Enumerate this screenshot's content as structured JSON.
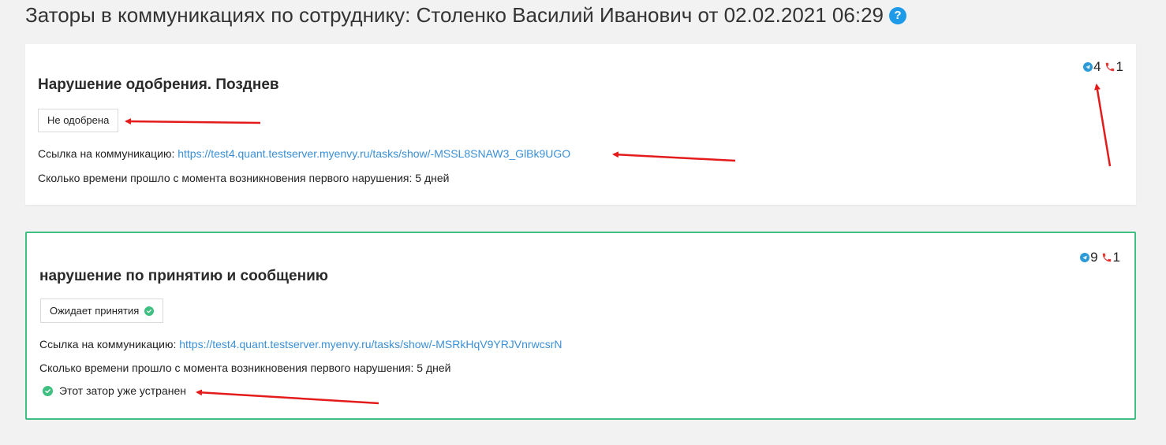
{
  "page": {
    "title": "Заторы в коммуникациях по сотруднику: Столенко Василий Иванович от 02.02.2021 06:29",
    "help_icon": "question-circle-icon"
  },
  "colors": {
    "accent_link": "#3a8fd6",
    "success": "#3fbf81",
    "telegram": "#2c9ad6",
    "phone": "#e53935",
    "annotation_arrow": "#e31b1b"
  },
  "cards": [
    {
      "title": "Нарушение одобрения. Позднев",
      "status": "Не одобрена",
      "status_icon": null,
      "link_label": "Ссылка на коммуникацию:",
      "link_url": "https://test4.quant.testserver.myenvy.ru/tasks/show/-MSSL8SNAW3_GlBk9UGO",
      "time_text": "Сколько времени прошло с момента возникновения первого нарушения: 5 дней",
      "telegram_count": "4",
      "phone_count": "1",
      "resolved": false
    },
    {
      "title": "нарушение по принятию и сообщению",
      "status": "Ожидает принятия",
      "status_icon": "check-circle-icon",
      "link_label": "Ссылка на коммуникацию:",
      "link_url": "https://test4.quant.testserver.myenvy.ru/tasks/show/-MSRkHqV9YRJVnrwcsrN",
      "time_text": "Сколько времени прошло с момента возникновения первого нарушения: 5 дней",
      "telegram_count": "9",
      "phone_count": "1",
      "resolved": true,
      "resolved_text": "Этот затор уже устранен",
      "highlighted": true
    }
  ]
}
